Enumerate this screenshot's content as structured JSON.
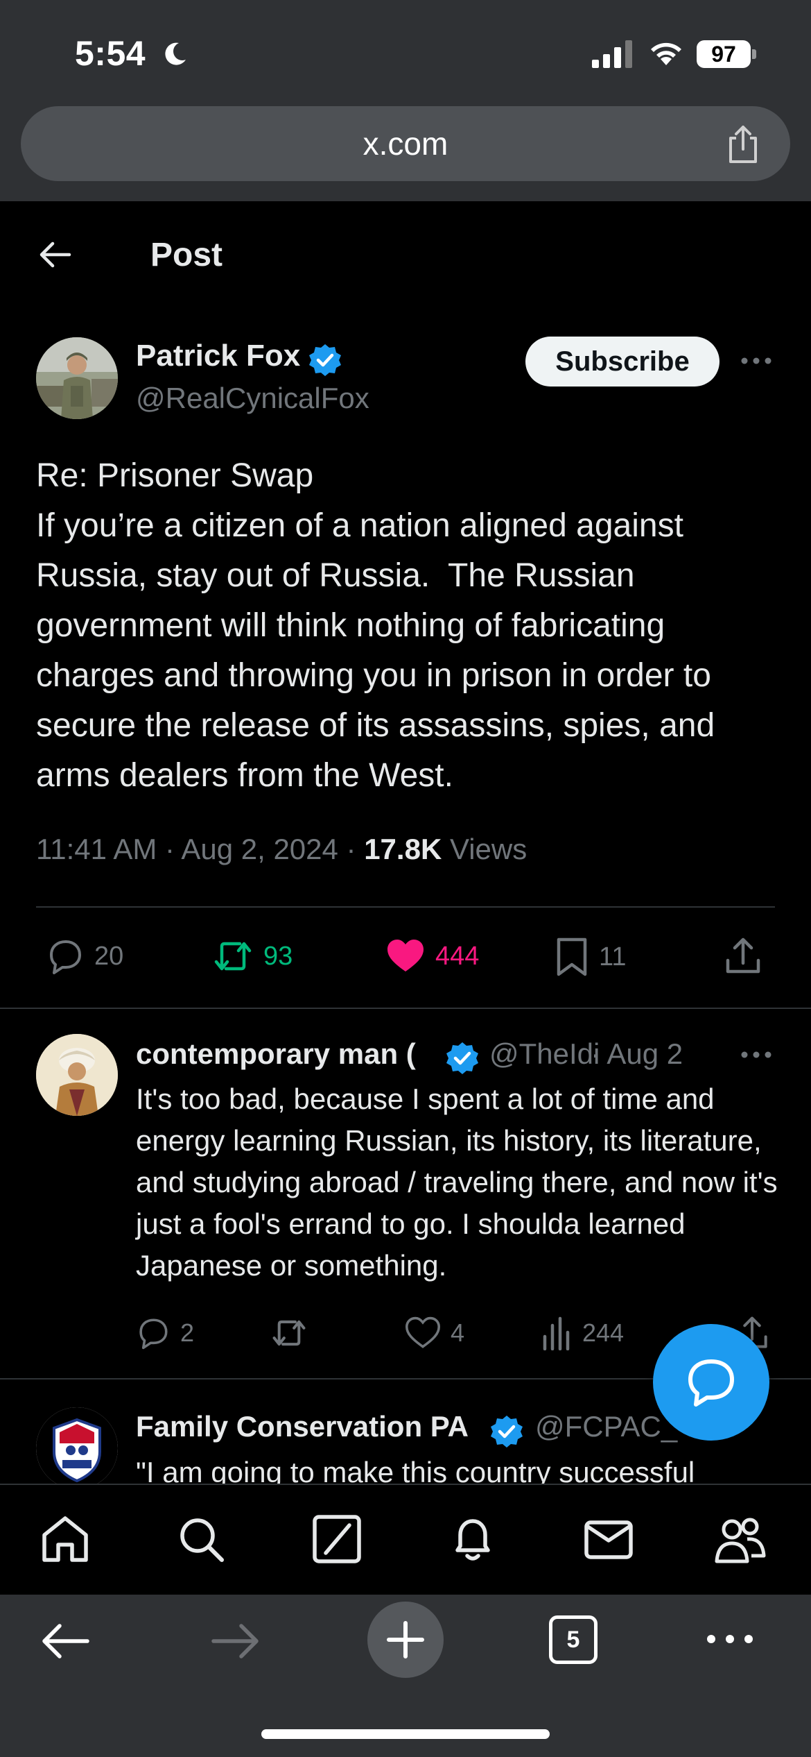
{
  "status_bar": {
    "time": "5:54",
    "battery": "97"
  },
  "browser": {
    "url": "x.com",
    "tabs_count": "5"
  },
  "header": {
    "title": "Post"
  },
  "post": {
    "author_name": "Patrick Fox",
    "author_handle": "@RealCynicalFox",
    "subscribe_label": "Subscribe",
    "body": "Re: Prisoner Swap\nIf you’re a citizen of a nation aligned against Russia, stay out of Russia.  The Russian government will think nothing of fabricating charges and throwing you in prison in order to secure the release of its assassins, spies, and arms dealers from the West.",
    "timestamp": "11:41 AM · Aug 2, 2024 · ",
    "views_count": "17.8K",
    "views_label": " Views",
    "stats": {
      "replies": "20",
      "reposts": "93",
      "likes": "444",
      "bookmarks": "11"
    }
  },
  "replies": [
    {
      "name": "contemporary man (",
      "handle": "@TheIdi",
      "time": "· Aug 2",
      "body": "It's too bad, because I spent a lot of time and energy learning Russian, its history, its literature, and studying abroad / traveling there, and now it's just a fool's errand to go. I shoulda learned Japanese or something.",
      "stats": {
        "replies": "2",
        "likes": "4",
        "views": "244"
      }
    },
    {
      "name": "Family Conservation PA",
      "handle": "@FCPAC_",
      "body": "\"I am going to make this country successful"
    }
  ],
  "colors": {
    "accent": "#1d9bf0",
    "like": "#f91880",
    "repost": "#00ba7c",
    "muted": "#71767b"
  }
}
